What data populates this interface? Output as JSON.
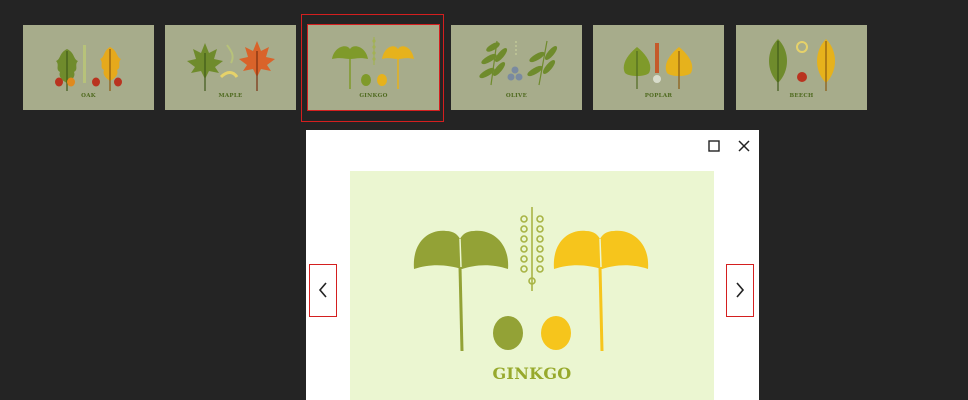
{
  "thumbnails": [
    {
      "label": "OAK"
    },
    {
      "label": "MAPLE"
    },
    {
      "label": "GINKGO",
      "selected": true
    },
    {
      "label": "OLIVE"
    },
    {
      "label": "POPLAR"
    },
    {
      "label": "BEECH"
    }
  ],
  "viewer": {
    "title": "GINKGO",
    "maximize_icon": "square-icon",
    "close_icon": "close-x-icon",
    "prev_icon": "chevron-left-icon",
    "next_icon": "chevron-right-icon"
  },
  "colors": {
    "background": "#242424",
    "selection": "#d41f1f",
    "thumb_bg": "#a7ac8b",
    "image_bg": "#ebf6d1",
    "leaf_green": "#93a236",
    "leaf_yellow": "#f6c51c"
  }
}
